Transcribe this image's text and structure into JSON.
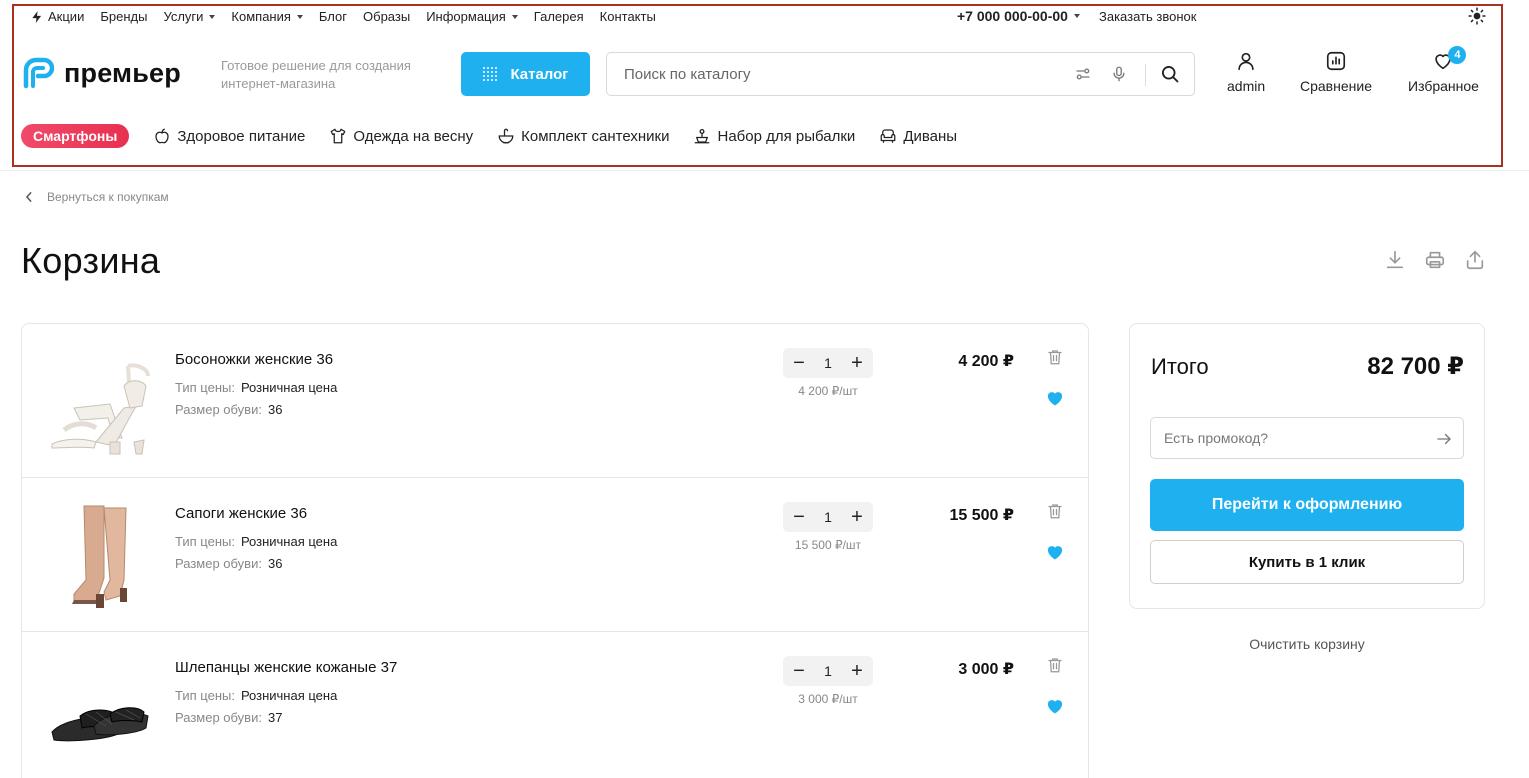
{
  "topbar": {
    "nav": [
      {
        "label": "Акции",
        "icon": "bolt-icon",
        "dropdown": false
      },
      {
        "label": "Бренды",
        "dropdown": false
      },
      {
        "label": "Услуги",
        "dropdown": true
      },
      {
        "label": "Компания",
        "dropdown": true
      },
      {
        "label": "Блог",
        "dropdown": false
      },
      {
        "label": "Образы",
        "dropdown": false
      },
      {
        "label": "Информация",
        "dropdown": true
      },
      {
        "label": "Галерея",
        "dropdown": false
      },
      {
        "label": "Контакты",
        "dropdown": false
      }
    ],
    "phone": "+7 000 000-00-00",
    "callback": "Заказать звонок",
    "theme_icon": "sun-icon"
  },
  "header": {
    "logo_text": "премьер",
    "tagline": "Готовое решение для создания интернет-магазина",
    "catalog_label": "Каталог",
    "search_placeholder": "Поиск по каталогу",
    "account_label": "admin",
    "compare_label": "Сравнение",
    "favorites_label": "Избранное",
    "favorites_count": "4",
    "accent_color": "#1fb0f0"
  },
  "categories": {
    "highlight": "Смартфоны",
    "items": [
      {
        "label": "Здоровое питание",
        "icon": "apple-icon"
      },
      {
        "label": "Одежда на весну",
        "icon": "shirt-icon"
      },
      {
        "label": "Комплект сантехники",
        "icon": "sink-icon"
      },
      {
        "label": "Набор для рыбалки",
        "icon": "fishing-icon"
      },
      {
        "label": "Диваны",
        "icon": "sofa-icon"
      }
    ]
  },
  "page": {
    "back_label": "Вернуться к покупкам",
    "title": "Корзина"
  },
  "cart": {
    "items": [
      {
        "name": "Босоножки женские 36",
        "price_type_label": "Тип цены:",
        "price_type": "Розничная цена",
        "size_label": "Размер обуви:",
        "size": "36",
        "qty": "1",
        "unit_price": "4 200 ₽/шт",
        "price": "4 200 ₽"
      },
      {
        "name": "Сапоги женские 36",
        "price_type_label": "Тип цены:",
        "price_type": "Розничная цена",
        "size_label": "Размер обуви:",
        "size": "36",
        "qty": "1",
        "unit_price": "15 500 ₽/шт",
        "price": "15 500 ₽"
      },
      {
        "name": "Шлепанцы женские кожаные 37",
        "price_type_label": "Тип цены:",
        "price_type": "Розничная цена",
        "size_label": "Размер обуви:",
        "size": "37",
        "qty": "1",
        "unit_price": "3 000 ₽/шт",
        "price": "3 000 ₽"
      }
    ]
  },
  "summary": {
    "total_label": "Итого",
    "total_value": "82 700 ₽",
    "promo_placeholder": "Есть промокод?",
    "checkout_label": "Перейти к оформлению",
    "oneclick_label": "Купить в 1 клик",
    "clear_label": "Очистить корзину"
  }
}
